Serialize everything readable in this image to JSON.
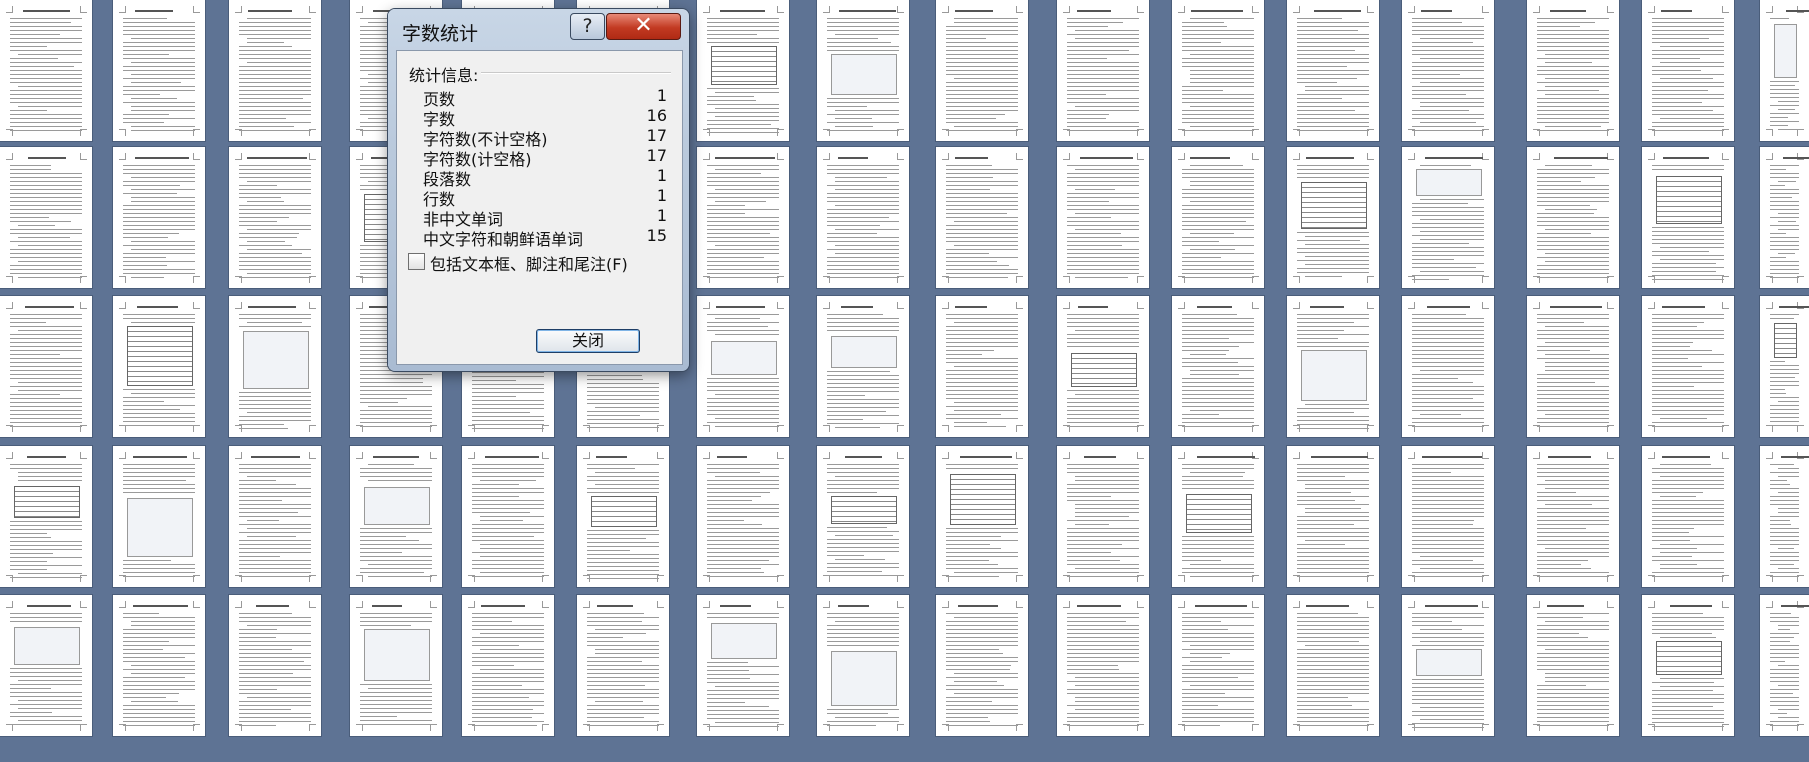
{
  "dialog": {
    "title": "字数统计",
    "help_label": "?",
    "close_label": "✕",
    "stats_label": "统计信息:",
    "stats": [
      {
        "label": "页数",
        "value": "1"
      },
      {
        "label": "字数",
        "value": "16"
      },
      {
        "label": "字符数(不计空格)",
        "value": "17"
      },
      {
        "label": "字符数(计空格)",
        "value": "17"
      },
      {
        "label": "段落数",
        "value": "1"
      },
      {
        "label": "行数",
        "value": "1"
      },
      {
        "label": "非中文单词",
        "value": "1"
      },
      {
        "label": "中文字符和朝鲜语单词",
        "value": "15"
      }
    ],
    "checkbox_label": "包括文本框、脚注和尾注(F)",
    "checkbox_checked": false,
    "ok_label": "关闭"
  },
  "background": {
    "description_icon": "page-thumbnail-grid",
    "page_color": "#ffffff",
    "desktop_color": "#5e7394"
  }
}
